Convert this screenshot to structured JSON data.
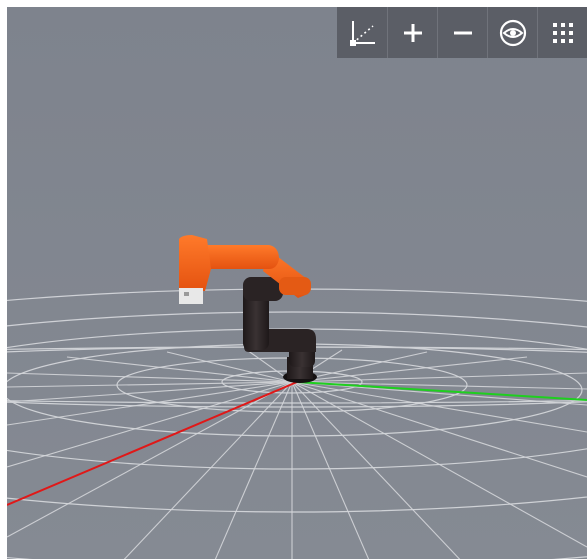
{
  "toolbar": {
    "buttons": [
      {
        "name": "axes-toggle",
        "icon": "axes-icon"
      },
      {
        "name": "zoom-in",
        "icon": "plus-icon"
      },
      {
        "name": "zoom-out",
        "icon": "minus-icon"
      },
      {
        "name": "visibility",
        "icon": "eye-icon"
      },
      {
        "name": "menu",
        "icon": "grid-dots-icon"
      }
    ]
  },
  "scene": {
    "background": "#808590",
    "grid_color": "#d4d6da",
    "x_axis_color": "#e01818",
    "y_axis_color": "#1ecf1e",
    "robot_link_color": "#f05a14",
    "robot_body_color": "#2a2324",
    "gripper_color": "#e8e8e8"
  }
}
